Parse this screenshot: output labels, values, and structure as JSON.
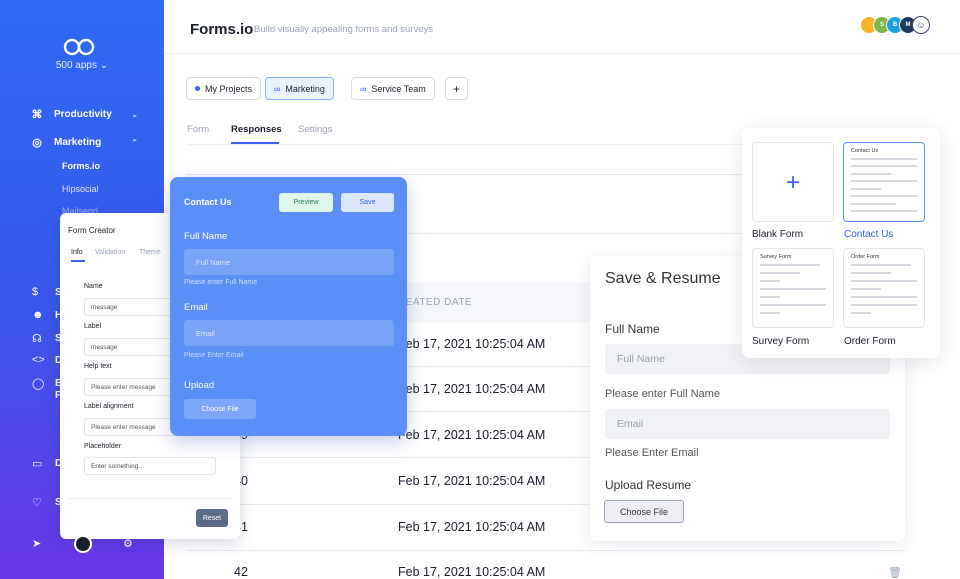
{
  "sidebar": {
    "apps_label": "500 apps",
    "items": [
      {
        "label": "Productivity",
        "icon": "command-icon"
      },
      {
        "label": "Marketing",
        "icon": "target-icon"
      }
    ],
    "sub_items": [
      "Forms.io",
      "Hipsocial",
      "Mailsend"
    ],
    "partial_letters": [
      "S",
      "H",
      "S",
      "D",
      "E",
      "F",
      "D",
      "S"
    ]
  },
  "header": {
    "title": "Forms.io",
    "subtitle": "Build visually appealing forms and surveys",
    "avatars": [
      {
        "initial": "",
        "color": "#f5b324"
      },
      {
        "initial": "S",
        "color": "#7fb848"
      },
      {
        "initial": "B",
        "color": "#1ea0d8"
      },
      {
        "initial": "M",
        "color": "#233a5e"
      }
    ]
  },
  "projects": {
    "chips": [
      "My Projects",
      "Marketing",
      "Service Team"
    ],
    "add_label": "+"
  },
  "tabs": [
    "Form",
    "Responses",
    "Settings"
  ],
  "table": {
    "header_date": "REATED DATE",
    "rows": [
      {
        "id": "",
        "date": "Feb 17, 2021 10:25:04 AM"
      },
      {
        "id": "",
        "date": "Feb 17, 2021 10:25:04 AM"
      },
      {
        "id": "39",
        "date": "Feb 17, 2021 10:25:04 AM"
      },
      {
        "id": "40",
        "date": "Feb 17, 2021 10:25:04 AM"
      },
      {
        "id": "41",
        "date": "Feb 17, 2021 10:25:04 AM"
      },
      {
        "id": "42",
        "date": "Feb 17, 2021 10:25:04 AM"
      }
    ]
  },
  "form_creator": {
    "title": "Form Creator",
    "tabs": [
      "Info",
      "Validation",
      "Theme"
    ],
    "fields": [
      {
        "label": "Name",
        "value": "message"
      },
      {
        "label": "Label",
        "value": "message"
      },
      {
        "label": "Help text",
        "value": "Please enter message"
      },
      {
        "label": "Label alignment",
        "value": "Please enter message"
      },
      {
        "label": "Placeholder",
        "value": "Enter something.."
      }
    ],
    "reset_label": "Reset"
  },
  "contact_card": {
    "title": "Contact Us",
    "preview_label": "Preview",
    "save_label": "Save",
    "full_name_label": "Full Name",
    "full_name_placeholder": "Full Name",
    "full_name_hint": "Please enter Full Name",
    "email_label": "Email",
    "email_placeholder": "Email",
    "email_hint": "Please Enter Email",
    "upload_label": "Upload",
    "file_button": "Choose File"
  },
  "resume_card": {
    "title": "Save & Resume",
    "full_name_label": "Full Name",
    "full_name_placeholder": "Full Name",
    "full_name_hint": "Please enter Full Name",
    "email_placeholder": "Email",
    "email_hint": "Please Enter Email",
    "upload_label": "Upload Resume",
    "file_button": "Choose File"
  },
  "templates": {
    "items": [
      {
        "label": "Blank Form",
        "head": ""
      },
      {
        "label": "Contact Us",
        "head": "Contact Us"
      },
      {
        "label": "Survey Form",
        "head": "Survey Form"
      },
      {
        "label": "Order Form",
        "head": "Order Form"
      }
    ]
  },
  "colors": {
    "accent": "#3a5ef0",
    "sidebar_top": "#2f6bf2",
    "sidebar_bottom": "#6a36e6",
    "contact_card": "#5b8ff5"
  }
}
